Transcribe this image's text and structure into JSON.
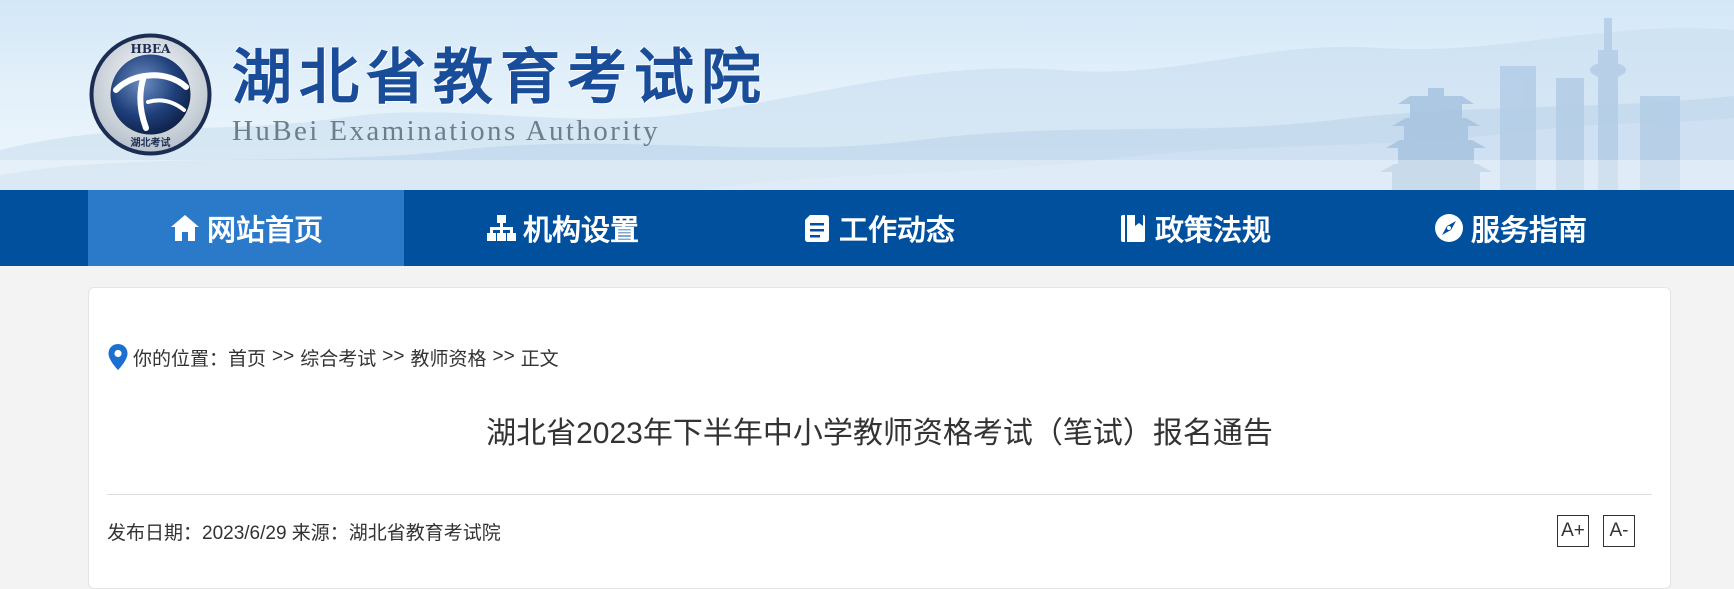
{
  "header": {
    "org_name": "湖北省教育考试院",
    "org_name_en": "HuBei Examinations Authority",
    "logo_ring_text": "HBEA",
    "logo_bottom_text": "湖北考试"
  },
  "nav": {
    "items": [
      {
        "label": "网站首页",
        "icon": "home-icon",
        "active": true
      },
      {
        "label": "机构设置",
        "icon": "org-chart-icon",
        "active": false
      },
      {
        "label": "工作动态",
        "icon": "document-icon",
        "active": false
      },
      {
        "label": "政策法规",
        "icon": "book-icon",
        "active": false
      },
      {
        "label": "服务指南",
        "icon": "compass-icon",
        "active": false
      }
    ]
  },
  "breadcrumb": {
    "prefix": "你的位置：",
    "items": [
      "首页",
      "综合考试",
      "教师资格",
      "正文"
    ],
    "separator": ">>"
  },
  "article": {
    "title": "湖北省2023年下半年中小学教师资格考试（笔试）报名通告",
    "meta": "发布日期：2023/6/29 来源：湖北省教育考试院",
    "font_increase_label": "A+",
    "font_decrease_label": "A-"
  },
  "colors": {
    "nav_bg": "#00509e",
    "nav_active_bg": "#2a7ac9",
    "title_blue": "#1a4d99",
    "pin_blue": "#1a6fd0"
  }
}
